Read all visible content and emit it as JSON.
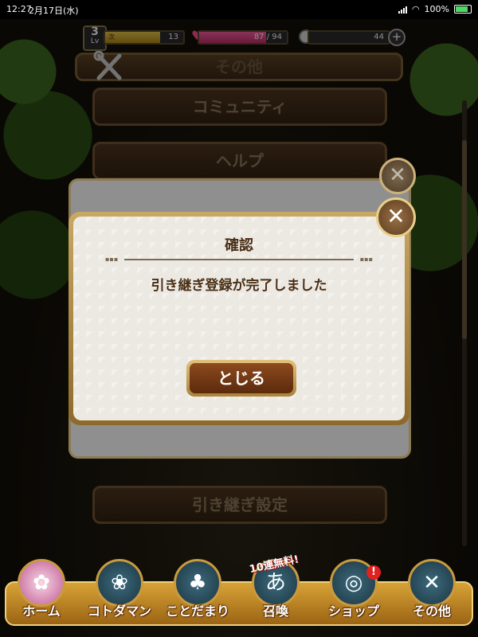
{
  "status_bar": {
    "time": "12:27",
    "date": "2月17日(水)",
    "battery": "100%"
  },
  "hud": {
    "rank_label": "Lv",
    "rank_value": "3",
    "exp_label": "次",
    "exp_value": "13",
    "hp_value": "87 / 94",
    "coins": "44"
  },
  "header": {
    "title": "その他"
  },
  "menu": [
    {
      "label": "コミュニティ"
    },
    {
      "label": "ヘルプ"
    },
    {
      "label": "引き継ぎ設定"
    }
  ],
  "confirm_dialog": {
    "title": "確認",
    "message": "引き継ぎ登録が完了しました",
    "button_label": "とじる",
    "close_glyph": "✕"
  },
  "nav": {
    "promo": "10連無料!",
    "badge": "!",
    "items": [
      {
        "label": "ホーム",
        "icon": "flower-icon"
      },
      {
        "label": "コトダマン",
        "icon": "characters-icon"
      },
      {
        "label": "ことだまり",
        "icon": "carrots-icon"
      },
      {
        "label": "召喚",
        "icon": "summon-icon"
      },
      {
        "label": "ショップ",
        "icon": "shop-icon"
      },
      {
        "label": "その他",
        "icon": "tools-icon"
      }
    ]
  },
  "colors": {
    "accent_brown": "#5b2a0c",
    "gold_border": "#c9a863",
    "dialog_bg": "#ece9e3"
  }
}
